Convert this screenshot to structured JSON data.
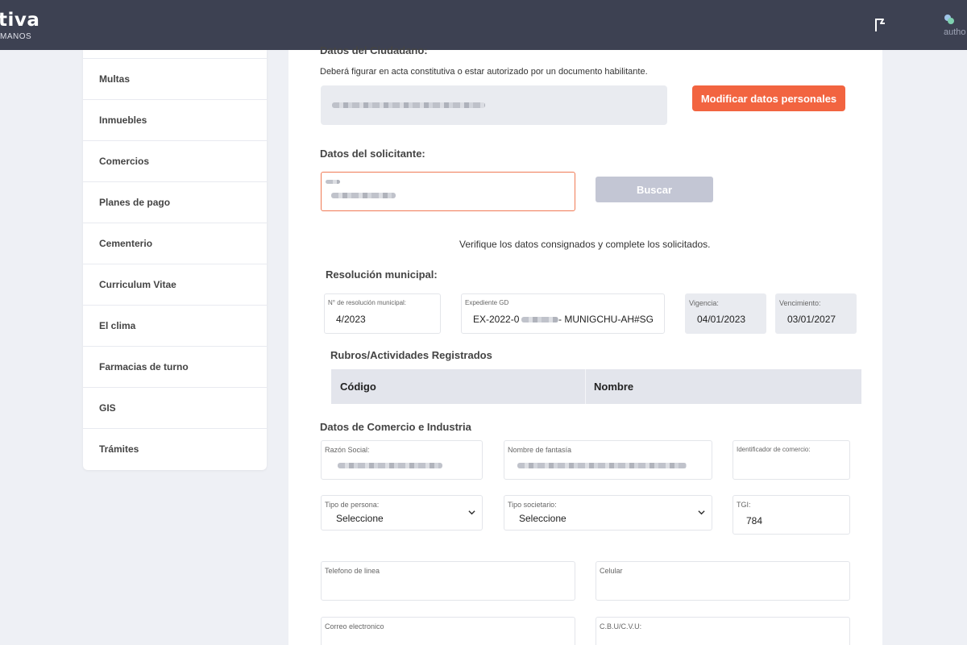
{
  "header": {
    "brand": "tiva",
    "brand_sub": "MANOS",
    "user_label": "autho"
  },
  "sidebar": {
    "items": [
      {
        "label": "Multas"
      },
      {
        "label": "Inmuebles"
      },
      {
        "label": "Comercios"
      },
      {
        "label": "Planes de pago"
      },
      {
        "label": "Cementerio"
      },
      {
        "label": "Curriculum Vitae"
      },
      {
        "label": "El clima"
      },
      {
        "label": "Farmacias de turno"
      },
      {
        "label": "GIS"
      },
      {
        "label": "Trámites"
      }
    ]
  },
  "ciudadano": {
    "title": "Datos del Ciudadano:",
    "note": "Deberá figurar en acta constitutiva o estar autorizado por un documento habilitante.",
    "modify_button": "Modificar datos personales"
  },
  "solicitante": {
    "title": "Datos del solicitante:",
    "search_button": "Buscar"
  },
  "verify_note": "Verifique los datos consignados y complete los solicitados.",
  "resolucion": {
    "title": "Resolución municipal:",
    "numero_label": "N° de resolución municipal:",
    "numero_value": "4/2023",
    "expediente_label": "Expediente GD",
    "expediente_prefix": "EX-2022-0",
    "expediente_suffix": "- MUNIGCHU-AH#SG",
    "vigencia_label": "Vigencia:",
    "vigencia_value": "04/01/2023",
    "vencimiento_label": "Vencimiento:",
    "vencimiento_value": "03/01/2027"
  },
  "rubros": {
    "title": "Rubros/Actividades Registrados",
    "columns": [
      "Código",
      "Nombre"
    ]
  },
  "comercio": {
    "title": "Datos de Comercio e Industria",
    "razon_social_label": "Razón Social:",
    "nombre_fantasia_label": "Nombre de fantasía",
    "identificador_label": "Identificador de comercio:",
    "tipo_persona_label": "Tipo de persona:",
    "tipo_persona_value": "Seleccione",
    "tipo_societario_label": "Tipo societario:",
    "tipo_societario_value": "Seleccione",
    "tgi_label": "TGI:",
    "tgi_value": "784",
    "telefono_label": "Telefono de linea",
    "celular_label": "Celular",
    "correo_label": "Correo electronico",
    "cbu_label": "C.B.U/C.V.U:"
  },
  "colors": {
    "topbar": "#3d4152",
    "accent_orange": "#f26440",
    "disabled_button": "#c3c6d4",
    "page_bg": "#eef0f5"
  }
}
